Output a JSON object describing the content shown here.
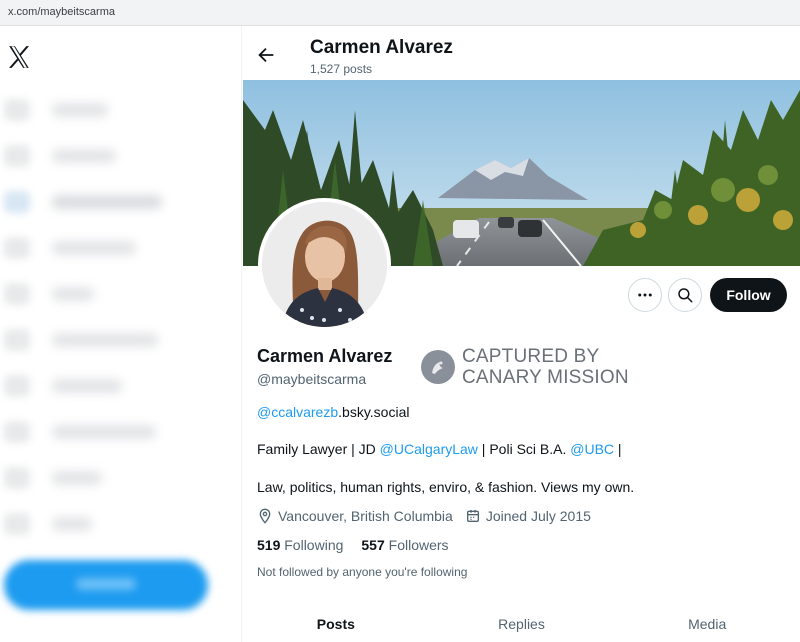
{
  "browser": {
    "url": "x.com/maybeitscarma"
  },
  "header": {
    "name": "Carmen Alvarez",
    "posts_count": "1,527 posts"
  },
  "profile": {
    "name": "Carmen Alvarez",
    "handle": "@maybeitscarma",
    "follow_label": "Follow",
    "bsky_link": "@ccalvarezb",
    "bsky_suffix": ".bsky.social",
    "bio_line1": {
      "part1": "Family Lawyer | JD ",
      "link1": "@UCalgaryLaw",
      "part2": " | Poli Sci B.A. ",
      "link2": "@UBC",
      "part3": " |"
    },
    "bio_line2": "Law, politics, human rights, enviro, & fashion. Views my own.",
    "location": "Vancouver, British Columbia",
    "joined": "Joined July 2015",
    "following_count": "519",
    "following_label": "Following",
    "followers_count": "557",
    "followers_label": "Followers",
    "not_followed": "Not followed by anyone you're following"
  },
  "watermark": {
    "line1": "CAPTURED BY",
    "line2": "CANARY MISSION"
  },
  "tabs": [
    {
      "label": "Posts"
    },
    {
      "label": "Replies"
    },
    {
      "label": "Media"
    }
  ],
  "icons": {
    "logo": "x-logo-icon",
    "back": "arrow-left-icon",
    "more": "more-horizontal-icon",
    "search": "search-icon",
    "location": "location-pin-icon",
    "calendar": "calendar-icon",
    "watermark": "canary-seal-icon"
  },
  "colors": {
    "accent": "#1d9bf0",
    "text": "#0f1419",
    "muted": "#536471",
    "button": "#0f1419"
  }
}
